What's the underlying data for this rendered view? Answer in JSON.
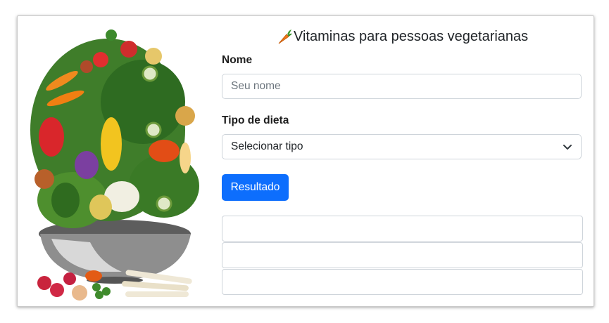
{
  "header": {
    "title": "Vitaminas para pessoas vegetarianas",
    "title_icon": "carrot-icon"
  },
  "form": {
    "name_label": "Nome",
    "name_placeholder": "Seu nome",
    "name_value": "",
    "diet_label": "Tipo de dieta",
    "diet_selected": "Selecionar tipo",
    "submit_label": "Resultado"
  },
  "results": [
    "",
    "",
    ""
  ],
  "colors": {
    "primary": "#0d6efd",
    "border": "#ced4da",
    "text": "#212529"
  },
  "illustration": {
    "subject": "bowl of assorted vegetables"
  }
}
